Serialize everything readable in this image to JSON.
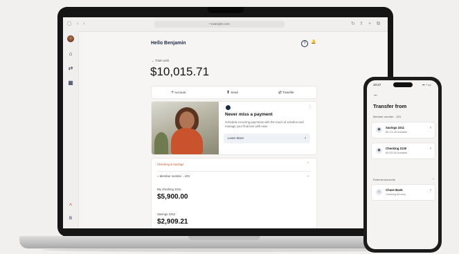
{
  "browser": {
    "url": "• example.com",
    "nav_icons": [
      "sidebar-icon",
      "back-icon",
      "forward-icon"
    ],
    "right_icons": [
      "reload-icon",
      "share-icon",
      "new-tab-icon",
      "tabs-icon"
    ]
  },
  "sidebar": {
    "items": [
      {
        "icon": "home-icon",
        "glyph": "⌂"
      },
      {
        "icon": "transfer-icon",
        "glyph": "⇄"
      },
      {
        "icon": "grid-icon",
        "glyph": "▦"
      }
    ],
    "bottom_logo": "^",
    "bottom_icon": "B"
  },
  "header": {
    "greeting": "Hello Benjamin",
    "help_glyph": "?",
    "bell_glyph": "🔔"
  },
  "summary": {
    "label": "Total cash",
    "amount": "$10,015.71"
  },
  "actions": [
    {
      "glyph": "+",
      "label": "Account"
    },
    {
      "glyph": "⬆",
      "label": "Send"
    },
    {
      "glyph": "⇄",
      "label": "Transfer"
    }
  ],
  "promo": {
    "title": "Never miss a payment",
    "description": "Schedule recurring payments with the touch of a button and manage your finances with ease",
    "button_label": "Learn More",
    "button_arrow": "›"
  },
  "accounts": {
    "section_label": "Checking & Savings",
    "member_label": "Member number ...201",
    "items": [
      {
        "name": "My checking 1011",
        "balance": "$5,900.00"
      },
      {
        "name": "Savings 1012",
        "balance": "$2,909.21"
      }
    ]
  },
  "phone": {
    "time": "10:27",
    "status": "▪▪ ◔ ▭",
    "title": "Transfer from",
    "member_label": "Member number ...201",
    "cards": [
      {
        "name": "Savings 1011",
        "sub": "$6,123.45 Available"
      },
      {
        "name": "Checking 2130",
        "sub": "$9,432.50 Available"
      }
    ],
    "external_label": "External accounts",
    "external_card": {
      "name": "Chase Bank",
      "sub": "Checking Account"
    }
  }
}
